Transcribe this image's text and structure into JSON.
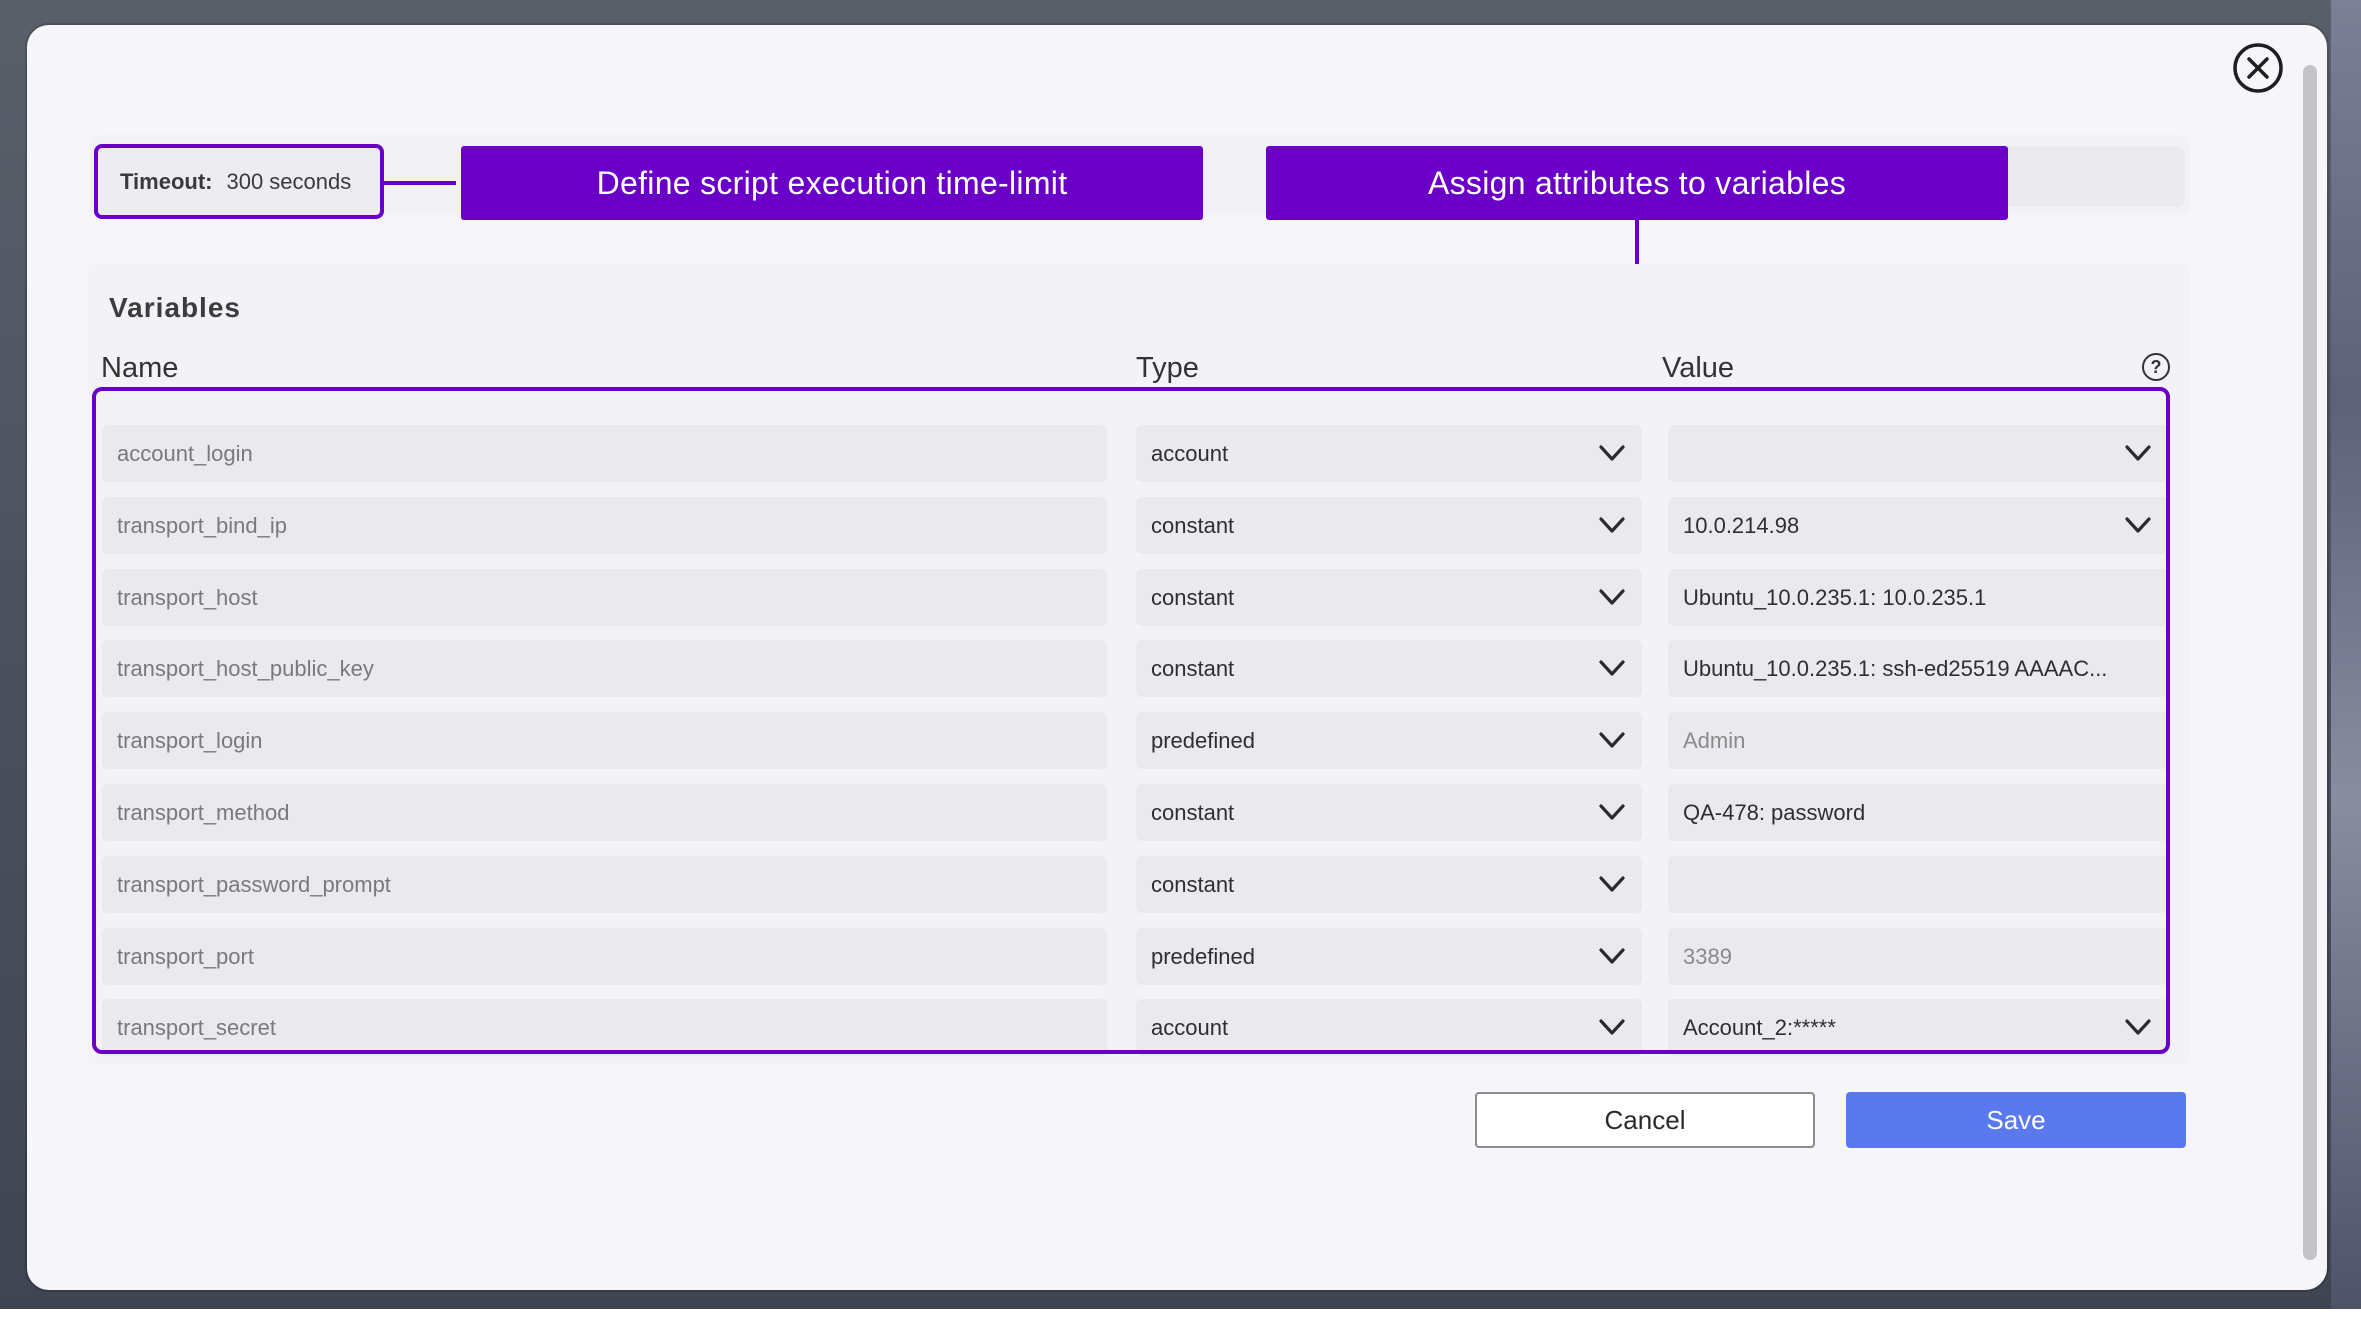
{
  "timeout": {
    "label": "Timeout:",
    "value": "300 seconds"
  },
  "callouts": {
    "timelimit": "Define script execution time-limit",
    "variables": "Assign attributes to variables"
  },
  "variables": {
    "title": "Variables",
    "columns": {
      "name": "Name",
      "type": "Type",
      "value": "Value"
    },
    "help_icon": "?",
    "rows": [
      {
        "name": "account_login",
        "type": "account",
        "value": "",
        "value_is_select": true,
        "value_muted": false
      },
      {
        "name": "transport_bind_ip",
        "type": "constant",
        "value": "10.0.214.98",
        "value_is_select": true,
        "value_muted": false
      },
      {
        "name": "transport_host",
        "type": "constant",
        "value": "Ubuntu_10.0.235.1: 10.0.235.1",
        "value_is_select": false,
        "value_muted": false
      },
      {
        "name": "transport_host_public_key",
        "type": "constant",
        "value": "Ubuntu_10.0.235.1: ssh-ed25519 AAAAC...",
        "value_is_select": false,
        "value_muted": false
      },
      {
        "name": "transport_login",
        "type": "predefined",
        "value": "Admin",
        "value_is_select": false,
        "value_muted": true
      },
      {
        "name": "transport_method",
        "type": "constant",
        "value": "QA-478: password",
        "value_is_select": false,
        "value_muted": false
      },
      {
        "name": "transport_password_prompt",
        "type": "constant",
        "value": "",
        "value_is_select": false,
        "value_muted": false
      },
      {
        "name": "transport_port",
        "type": "predefined",
        "value": "3389",
        "value_is_select": false,
        "value_muted": true
      },
      {
        "name": "transport_secret",
        "type": "account",
        "value": "Account_2:*****",
        "value_is_select": true,
        "value_muted": false
      }
    ]
  },
  "buttons": {
    "cancel": "Cancel",
    "save": "Save"
  },
  "icons": {
    "close": "close-icon",
    "chevron": "chevron-down-icon",
    "help": "help-icon"
  },
  "colors": {
    "accent": "#6a00c8",
    "primary_button": "#5b79ef",
    "modal_bg": "#f6f6fa",
    "cell_bg": "#e9e9ee"
  }
}
